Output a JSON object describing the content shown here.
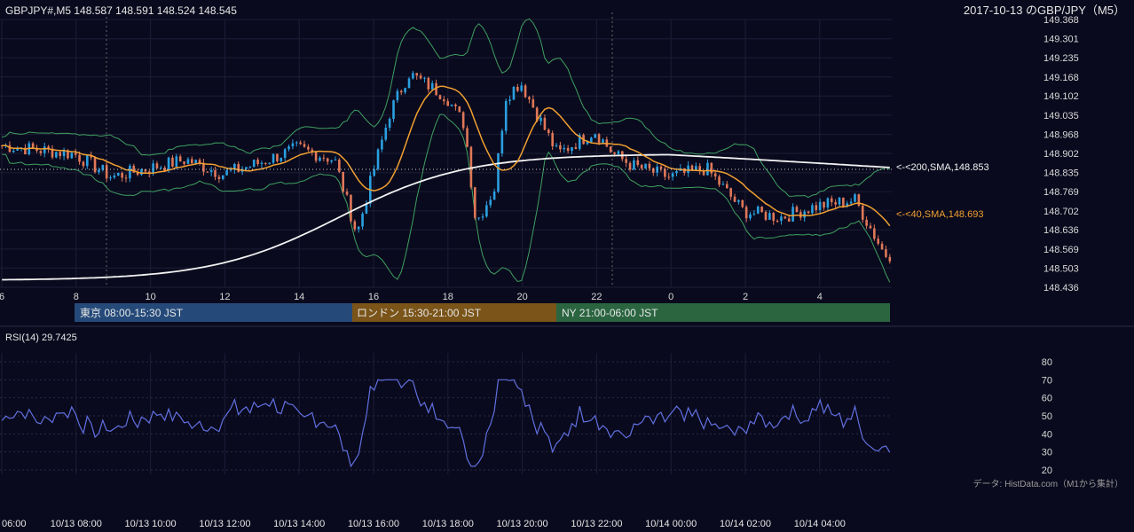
{
  "header": {
    "ohlc_label": "GBPJPY#,M5 148.587 148.591 148.524 148.545",
    "title": "2017-10-13 のGBP/JPY（M5）"
  },
  "sessions": [
    {
      "label": "東京 08:00-15:30 JST",
      "color": "#254a7a"
    },
    {
      "label": "ロンドン 15:30-21:00 JST",
      "color": "#7a5418"
    },
    {
      "label": "NY 21:00-06:00 JST",
      "color": "#2a6540"
    }
  ],
  "annotations": {
    "sma200": "<-<200,SMA,148.853",
    "sma40": "<-<40,SMA,148.693"
  },
  "rsi_label": "RSI(14) 29.7425",
  "source_note": "データ: HistData.com（M1から集計）",
  "colors": {
    "background": "#0a0a1e",
    "up_candle": "#2aa0e0",
    "down_candle": "#e07858",
    "sma40": "#f0a030",
    "sma200": "#f2f2f2",
    "bollinger": "#3ea060",
    "rsi": "#6070e0"
  },
  "chart_data": {
    "type": "candlestick",
    "price_axis": {
      "ticks": [
        "149.368",
        "149.301",
        "149.235",
        "149.168",
        "149.102",
        "149.035",
        "148.968",
        "148.902",
        "148.835",
        "148.769",
        "148.702",
        "148.636",
        "148.569",
        "148.503",
        "148.436"
      ],
      "range": [
        148.436,
        149.368
      ]
    },
    "hour_ticks": [
      "6",
      "8",
      "10",
      "12",
      "14",
      "16",
      "18",
      "20",
      "22",
      "0",
      "2",
      "4"
    ],
    "datetime_ticks": [
      "06:00",
      "10/13 08:00",
      "10/13 10:00",
      "10/13 12:00",
      "10/13 14:00",
      "10/13 16:00",
      "10/13 18:00",
      "10/13 20:00",
      "10/13 22:00",
      "10/14 00:00",
      "10/14 02:00",
      "10/14 04:00"
    ],
    "rsi_axis": {
      "ticks": [
        "80",
        "70",
        "60",
        "50",
        "40",
        "30",
        "20"
      ],
      "range": [
        20,
        80
      ]
    },
    "series": [
      {
        "name": "SMA 200",
        "start": 148.46,
        "end": 148.853
      },
      {
        "name": "SMA 40",
        "last": 148.693
      },
      {
        "name": "RSI(14)",
        "last": 29.7425
      }
    ],
    "price_profile": [
      [
        0,
        148.88
      ],
      [
        6,
        148.93
      ],
      [
        8,
        148.9
      ],
      [
        9,
        148.82
      ],
      [
        11,
        148.88
      ],
      [
        12,
        148.83
      ],
      [
        13,
        148.87
      ],
      [
        14,
        148.92
      ],
      [
        15,
        148.88
      ],
      [
        15.6,
        148.62
      ],
      [
        16,
        148.82
      ],
      [
        16.5,
        149.05
      ],
      [
        17,
        149.18
      ],
      [
        18,
        149.1
      ],
      [
        18.5,
        149.0
      ],
      [
        18.8,
        148.66
      ],
      [
        19.3,
        148.78
      ],
      [
        19.6,
        149.1
      ],
      [
        20,
        149.15
      ],
      [
        20.6,
        149.0
      ],
      [
        21,
        148.9
      ],
      [
        22,
        148.98
      ],
      [
        22.5,
        148.9
      ],
      [
        23,
        148.86
      ],
      [
        0,
        148.82
      ],
      [
        1,
        148.85
      ],
      [
        2,
        148.7
      ],
      [
        3,
        148.68
      ],
      [
        4,
        148.72
      ],
      [
        5,
        148.74
      ],
      [
        5.8,
        148.55
      ]
    ]
  }
}
